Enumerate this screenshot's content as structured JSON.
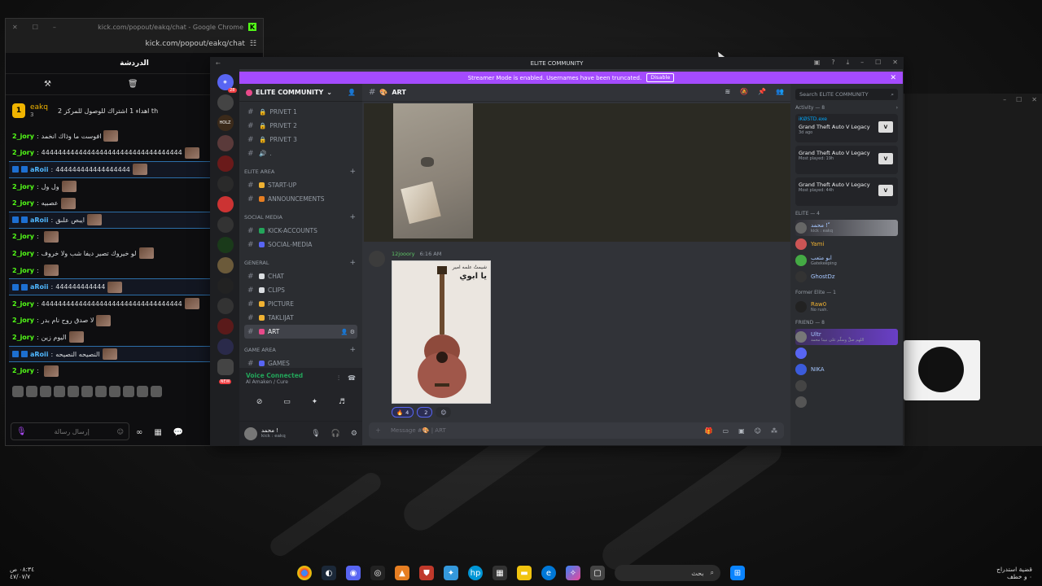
{
  "chrome": {
    "title": "kick.com/popout/eakq/chat - Google Chrome",
    "url": "kick.com/popout/eakq/chat",
    "chat_title": "الدردشة",
    "pinned_user": "eakq",
    "pinned_count": "3",
    "pinned_text": "اهداء 1 اشتراك للوصول للمركز 2 th",
    "input_placeholder": "إرسال رسالة",
    "messages": [
      {
        "user": "2_jory",
        "text": "افوست ما وذاك انخمد"
      },
      {
        "user": "2_jory",
        "text": "4444444444444444444444444444444444"
      },
      {
        "user": "aRoii",
        "text": "444444444444444444",
        "blue": true
      },
      {
        "user": "2_jory",
        "text": "ول ول"
      },
      {
        "user": "2_jory",
        "text": "عصبيه"
      },
      {
        "user": "aRoii",
        "text": "ايبص علىق",
        "blue": true
      },
      {
        "user": "2_jory",
        "text": ""
      },
      {
        "user": "2_jory",
        "text": "لو خيروك تصير ديفا شب ولا خروف"
      },
      {
        "user": "2_jory",
        "text": ""
      },
      {
        "user": "aRoii",
        "text": "444444444444",
        "blue": true
      },
      {
        "user": "2_jory",
        "text": "4444444444444444444444444444444444"
      },
      {
        "user": "2_jory",
        "text": "لا صدق روح نام بدر"
      },
      {
        "user": "2_jory",
        "text": "اليوم زين"
      },
      {
        "user": "aRoii",
        "text": "النصيحه النصيحه",
        "blue": true
      },
      {
        "user": "2_jory",
        "text": ""
      }
    ]
  },
  "discord": {
    "window_title": "ELITE COMMUNITY",
    "streamer_text": "Streamer Mode is enabled. Usernames have been truncated.",
    "disable_label": "Disable",
    "server_name": "ELITE COMMUNITY",
    "guild_badge": "28",
    "new_label": "NEW",
    "channels": [
      {
        "name": "PRIVET 1",
        "icon": "lock"
      },
      {
        "name": "PRIVET 2",
        "icon": "lock"
      },
      {
        "name": "PRIVET 3",
        "icon": "lock"
      },
      {
        "name": ".",
        "icon": "speaker"
      }
    ],
    "categories": [
      {
        "name": "ELITE AREA",
        "channels": [
          "START-UP",
          "ANNOUNCEMENTS"
        ]
      },
      {
        "name": "SOCIAL MEDIA",
        "channels": [
          "KICK-ACCOUNTS",
          "SOCIAL-MEDIA"
        ]
      },
      {
        "name": "GENERAL",
        "channels": [
          "CHAT",
          "CLIPS",
          "PICTURE",
          "TAKLIJAT",
          "ART"
        ]
      },
      {
        "name": "GAME AREA",
        "channels": [
          "GAMES"
        ]
      }
    ],
    "active_channel": "ART",
    "voice_status": "Voice Connected",
    "voice_sub": "Al Amaken / Cure",
    "user_name": "محمد !",
    "user_status": "kick : eakq",
    "message_author": "12jooory",
    "message_time": "6:16 AM",
    "poster_title": "يا ابوي",
    "poster_header": "شيمتُ علمه امير",
    "reactions": [
      {
        "emoji": "🔥",
        "count": "4"
      },
      {
        "emoji": "",
        "count": "2"
      }
    ],
    "composer_placeholder": "Message #🎨 | ART",
    "search_placeholder": "Search ELITE COMMUNITY",
    "activity_header": "Activity — 8",
    "activities": [
      {
        "user": "iKØSTD.exe",
        "game": "Grand Theft Auto V Legacy",
        "meta": "3d ago"
      },
      {
        "user": "",
        "game": "Grand Theft Auto V Legacy",
        "meta": "Most played: 19h"
      },
      {
        "user": "",
        "game": "Grand Theft Auto V Legacy",
        "meta": "Most played: 44h"
      }
    ],
    "elite_header": "ELITE — 4",
    "elite": [
      {
        "name": "محمد ! ّ",
        "sub": "kick : eakq",
        "hl": true
      },
      {
        "name": "Yami",
        "sub": ""
      },
      {
        "name": "ابو متعب",
        "sub": "Gatekeeping"
      },
      {
        "name": "GhostDz",
        "sub": ""
      }
    ],
    "former_header": "Former Elite — 1",
    "former": [
      {
        "name": "Raw0",
        "sub": "No rush."
      }
    ],
    "friend_header": "FRIEND — 8",
    "friends": [
      {
        "name": "Ultr",
        "sub": "اللهم صلِّ وسلّم على نبينا محمد"
      },
      {
        "name": "",
        "sub": ""
      },
      {
        "name": "NIKA",
        "sub": ""
      },
      {
        "name": "",
        "sub": ""
      },
      {
        "name": "",
        "sub": ""
      }
    ]
  },
  "taskbar": {
    "search_label": "بحث",
    "clock_time": "٠٨:٣٤ ص",
    "clock_date": "٤٧/٠٧/٧",
    "news_line1": "قضية استدراج",
    "news_line2": "٠ و خطف"
  },
  "colors": {
    "discord_accent": "#a44bff",
    "kick_green": "#53fc18",
    "online": "#23a55a"
  }
}
